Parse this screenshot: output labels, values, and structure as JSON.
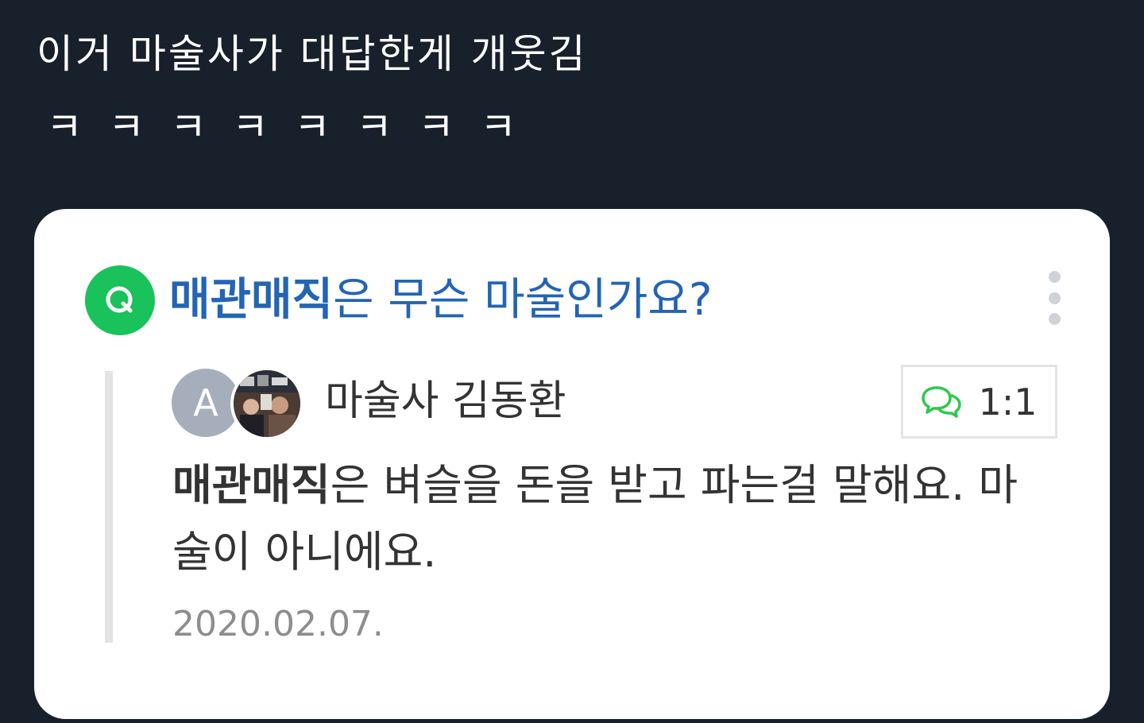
{
  "tweet": {
    "line1": "이거 마술사가 대답한게 개웃김",
    "line2": "ㅋㅋㅋㅋㅋㅋㅋㅋ"
  },
  "card": {
    "q_label": "Q",
    "question_keyword": "매관매직",
    "question_rest": "은 무슨 마술인가요?",
    "more_icon": "more-vertical-icon",
    "answer": {
      "avatar_letter": "A",
      "avatar_photo_icon": "profile-photo",
      "author": "마술사 김동환",
      "chat_icon": "chat-bubbles-icon",
      "chat_label": "1:1",
      "body_keyword": "매관매직",
      "body_rest": "은 벼슬을 돈을 받고 파는걸 말해요. 마술이 아니에요.",
      "date": "2020.02.07."
    }
  },
  "colors": {
    "background": "#17202b",
    "card": "#ffffff",
    "q_badge": "#19c25a",
    "question": "#2364b4",
    "chat_icon": "#2ec84d",
    "text": "#333333",
    "date": "#8d8d8d"
  }
}
